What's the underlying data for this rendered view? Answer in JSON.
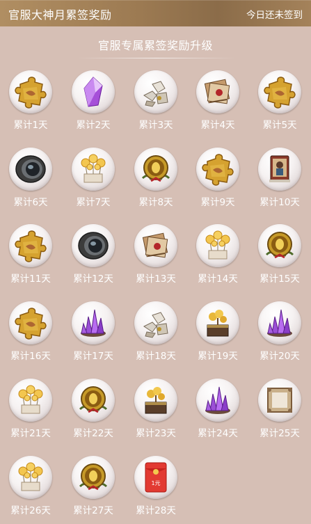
{
  "header": {
    "title": "官服大神月累签奖励",
    "status": "今日还未签到",
    "color_start": "#b08e62",
    "color_end": "#8b6c49"
  },
  "subtitle": "官服专属累签奖励升级",
  "background_color": "#d6bfb5",
  "days": [
    {
      "label": "累计1天",
      "icon": "puzzle-piece-icon"
    },
    {
      "label": "累计2天",
      "icon": "purple-crystal-icon"
    },
    {
      "label": "累计3天",
      "icon": "puzzle-pieces-pile-icon"
    },
    {
      "label": "累计4天",
      "icon": "scroll-letter-icon"
    },
    {
      "label": "累计5天",
      "icon": "puzzle-piece-icon"
    },
    {
      "label": "累计6天",
      "icon": "camera-lens-icon"
    },
    {
      "label": "累计7天",
      "icon": "golden-balloons-icon"
    },
    {
      "label": "累计8天",
      "icon": "golden-egg-emblem-icon"
    },
    {
      "label": "累计9天",
      "icon": "puzzle-piece-icon"
    },
    {
      "label": "累计10天",
      "icon": "character-card-icon"
    },
    {
      "label": "累计11天",
      "icon": "puzzle-piece-icon"
    },
    {
      "label": "累计12天",
      "icon": "camera-lens-icon"
    },
    {
      "label": "累计13天",
      "icon": "scroll-letter-icon"
    },
    {
      "label": "累计14天",
      "icon": "golden-balloons-icon"
    },
    {
      "label": "累计15天",
      "icon": "golden-egg-emblem-icon"
    },
    {
      "label": "累计16天",
      "icon": "puzzle-piece-icon"
    },
    {
      "label": "累计17天",
      "icon": "purple-crystal-cluster-icon"
    },
    {
      "label": "累计18天",
      "icon": "puzzle-pieces-pile-icon"
    },
    {
      "label": "累计19天",
      "icon": "golden-tree-chest-icon"
    },
    {
      "label": "累计20天",
      "icon": "purple-crystal-cluster-icon"
    },
    {
      "label": "累计21天",
      "icon": "golden-balloons-icon"
    },
    {
      "label": "累计22天",
      "icon": "golden-egg-emblem-icon"
    },
    {
      "label": "累计23天",
      "icon": "golden-tree-chest-icon"
    },
    {
      "label": "累计24天",
      "icon": "purple-crystal-cluster-icon"
    },
    {
      "label": "累计25天",
      "icon": "ornate-frame-icon"
    },
    {
      "label": "累计26天",
      "icon": "golden-balloons-icon"
    },
    {
      "label": "累计27天",
      "icon": "golden-egg-emblem-icon"
    },
    {
      "label": "累计28天",
      "icon": "red-envelope-icon",
      "envelope_text": "1元"
    }
  ]
}
